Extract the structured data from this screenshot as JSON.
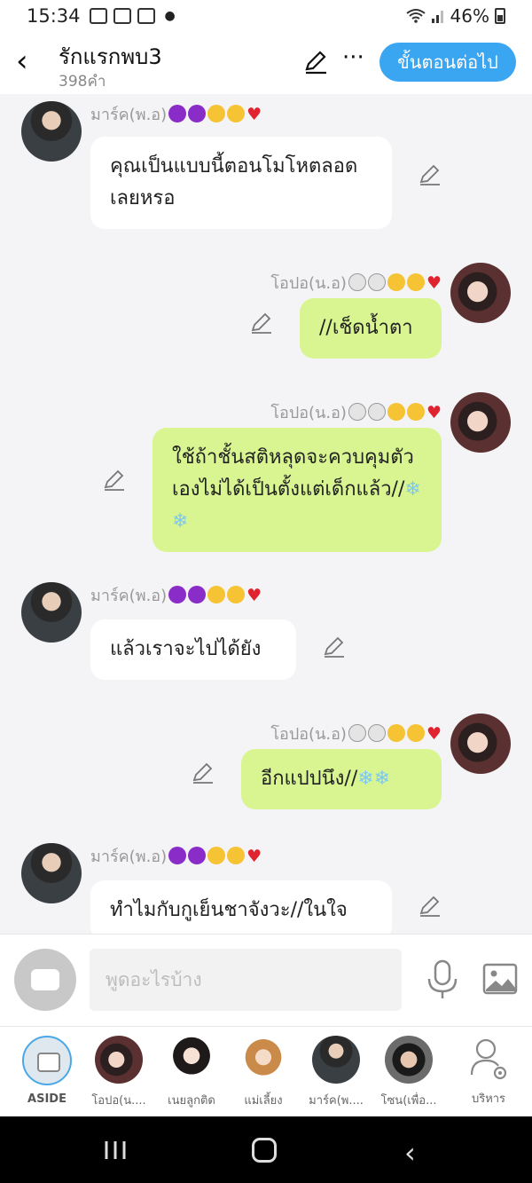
{
  "status": {
    "time": "15:34",
    "battery": "46%"
  },
  "header": {
    "title": "รักแรกพบ3",
    "subtitle": "398คำ",
    "next_label": "ขั้นตอนต่อไป"
  },
  "messages": [
    {
      "side": "left",
      "speaker": "มาร์ค(พ.อ)",
      "text": "คุณเป็นแบบนี้ตอนโมโหตลอดเลยหรอ"
    },
    {
      "side": "right",
      "speaker": "โอปอ(น.อ)",
      "text": "//เช็ดน้ำตา"
    },
    {
      "side": "right",
      "speaker": "โอปอ(น.อ)",
      "text": "ใช้ถ้าชั้นสติหลุดจะควบคุมตัวเองไม่ได้เป็นตั้งแต่เด็กแล้ว//"
    },
    {
      "side": "left",
      "speaker": "มาร์ค(พ.อ)",
      "text": "แล้วเราจะไปได้ยัง"
    },
    {
      "side": "right",
      "speaker": "โอปอ(น.อ)",
      "text": "อีกแปปนึง//"
    },
    {
      "side": "left",
      "speaker": "มาร์ค(พ.อ)",
      "text": "ทำไมกับกูเย็นชาจังวะ//ในใจ"
    }
  ],
  "input": {
    "placeholder": "พูดอะไรบ้าง"
  },
  "characters": [
    {
      "label": "ASIDE"
    },
    {
      "label": "โอปอ(น...."
    },
    {
      "label": "เนยลูกติด"
    },
    {
      "label": "แม่เลี้ยง"
    },
    {
      "label": "มาร์ค(พ...."
    },
    {
      "label": "โซน(เพื่อ..."
    },
    {
      "label": "บริหาร"
    }
  ],
  "colors": {
    "accent": "#3aa5f0",
    "right_bubble": "#d8f592",
    "left_bubble": "#ffffff"
  }
}
